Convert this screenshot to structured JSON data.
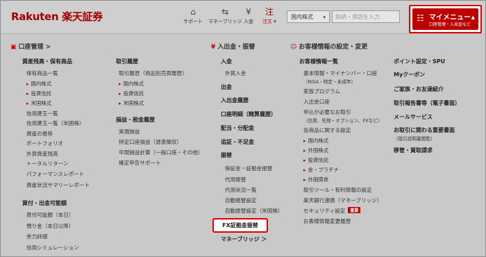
{
  "header": {
    "logo": "Rakuten 楽天証券",
    "icons": [
      {
        "name": "support-icon",
        "label": "サポート",
        "glyph": "⌂"
      },
      {
        "name": "money-bridge-icon",
        "label": "マネーブリッジ",
        "glyph": "⇆"
      },
      {
        "name": "deposit-icon",
        "label": "入金",
        "glyph": "¥"
      },
      {
        "name": "order-icon",
        "label": "注文 ▾",
        "glyph": "注"
      }
    ],
    "product_select": "国内株式",
    "search_placeholder": "銘柄・用語を入力",
    "my_menu": {
      "title": "マイメニュー",
      "subtitle": "口座管理・入出金など",
      "icon": "☷"
    }
  },
  "account": {
    "heading": "口座管理 >",
    "icon": "▣",
    "col1": {
      "assets": {
        "title": "資産残高・保有商品",
        "items": [
          "保有商品一覧"
        ],
        "subs": [
          "国内株式",
          "投資信託",
          "米国株式"
        ],
        "items2": [
          "信用建玉一覧",
          "信用建玉一覧（米国株）",
          "資産の推移",
          "ポートフォリオ",
          "外貨資産残高",
          "トータルリターン",
          "パフォーマンスレポート",
          "資産状況サマリーレポート"
        ]
      },
      "trading": {
        "title": "買付・出金可能額",
        "items": [
          "買付可能額（本日）",
          "預り金（本日以降）",
          "余力詳細",
          "信用シミュレーション"
        ]
      }
    },
    "col2": {
      "history": {
        "title": "取引履歴",
        "items": [
          "取引履歴（商品別売買履歴）"
        ],
        "subs": [
          "国内株式",
          "投資信託",
          "米国株式"
        ]
      },
      "pnl": {
        "title": "損益・税金履歴",
        "items": [
          "実現損益",
          "特定口座損益（源泉徴収）",
          "年間損益計算（一般口座・その他）",
          "確定申告サポート"
        ]
      }
    }
  },
  "funds": {
    "heading": "入出金・振替",
    "icon": "¥",
    "items": [
      "入金",
      "外貨入金",
      "出金",
      "入出金履歴",
      "口座明細（精算履歴）",
      "配当・分配金",
      "追証・不足金",
      "振替"
    ],
    "transfer_items": [
      "保証金・証拠金振替",
      "代用振替",
      "代用状況一覧",
      "自動振替設定",
      "自動振替設定（米国株）"
    ],
    "fx_transfer": "FX証拠金振替",
    "money_bridge": "マネーブリッジ ＞"
  },
  "customer": {
    "heading": "お客様情報の設定・変更",
    "icon": "☺",
    "list_title": "お客様情報一覧",
    "items_a": [
      "基本情報・マイナンバー・口座",
      "（NISA・特定・未成年）",
      "家族プログラム",
      "入出金口座",
      "申込が必要なお取引",
      "（信用、先物・オプション、FXなど）",
      "各商品に関する設定"
    ],
    "subs": [
      "国内株式",
      "外国株式",
      "投資信託",
      "金・プラチナ",
      "外国債券"
    ],
    "items_b": [
      "取引ツール・有料情報の設定",
      "楽天銀行連携（マネーブリッジ）",
      "セキュリティ設定",
      "お客様情報変更履歴"
    ],
    "security_badge": "重要",
    "right": [
      "ポイント設定・SPU",
      "Myクーポン",
      "ご家族・お友達紹介",
      "取引報告書等（電子書面）",
      "メールサービス",
      "お取引に関わる重要書面",
      "（取引説明書閲覧）",
      "移管・買取請求"
    ]
  }
}
